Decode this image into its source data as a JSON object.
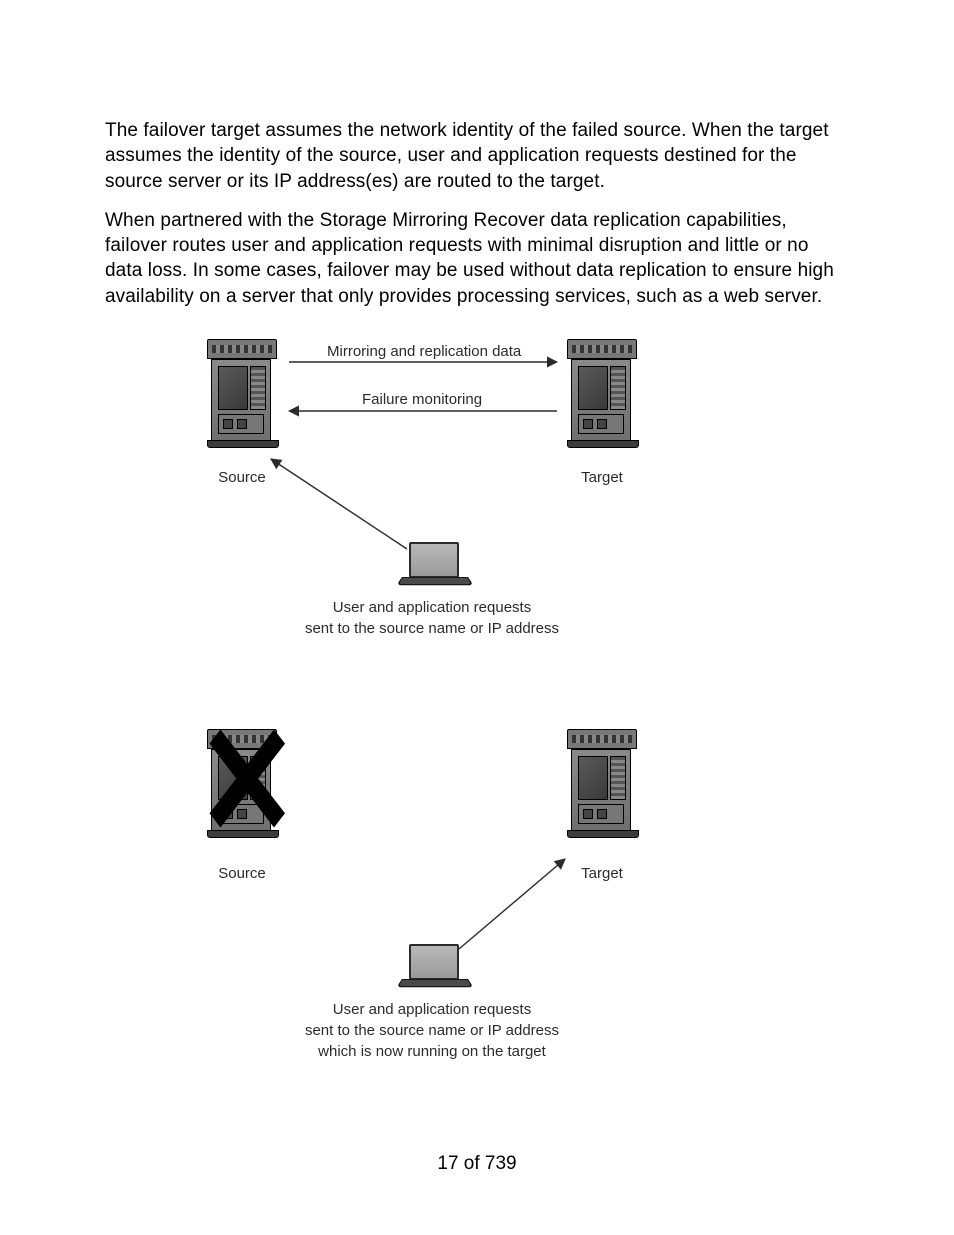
{
  "paragraphs": {
    "p1": "The failover target assumes the network identity of the failed source. When the target assumes the identity of the source, user and application requests destined for the source server or its IP address(es) are routed to the target.",
    "p2": "When partnered with the Storage Mirroring Recover data replication capabilities, failover routes user and application requests with minimal disruption and little or no data loss. In some cases, failover may be used without data replication to ensure high availability on a server that only provides processing services, such as a web server."
  },
  "diagram1": {
    "mirror_label": "Mirroring and replication data",
    "failure_label": "Failure monitoring",
    "source_label": "Source",
    "target_label": "Target",
    "caption_line1": "User and application requests",
    "caption_line2": "sent to the source name or IP address"
  },
  "diagram2": {
    "source_label": "Source",
    "target_label": "Target",
    "caption_line1": "User and application requests",
    "caption_line2": "sent to the source name or IP address",
    "caption_line3": "which is now running on the target"
  },
  "footer": {
    "page": "17 of 739"
  }
}
